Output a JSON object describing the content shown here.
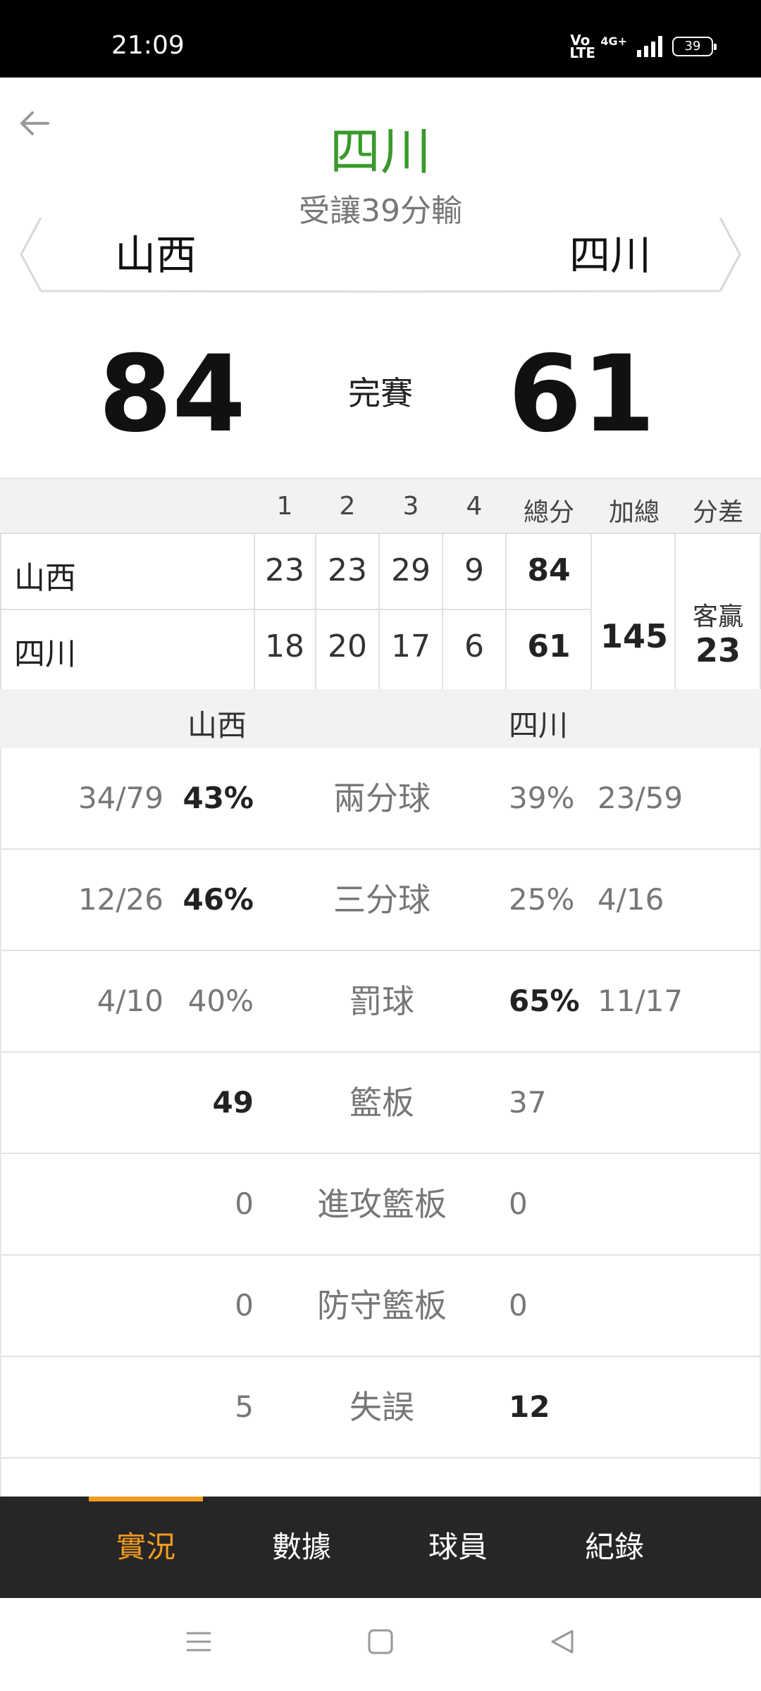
{
  "status_bar": {
    "time": "21:09",
    "volte": "Vo LTE",
    "network": "4G+",
    "battery": "39"
  },
  "header": {
    "winner": "四川",
    "handicap_result": "受讓39分輸",
    "home_team": "山西",
    "away_team": "四川"
  },
  "score": {
    "home": "84",
    "status": "完賽",
    "away": "61"
  },
  "quarter_table": {
    "headers": [
      "1",
      "2",
      "3",
      "4",
      "總分",
      "加總",
      "分差"
    ],
    "rows": [
      {
        "team": "山西",
        "q": [
          "23",
          "23",
          "29",
          "9"
        ],
        "total": "84"
      },
      {
        "team": "四川",
        "q": [
          "18",
          "20",
          "17",
          "6"
        ],
        "total": "61"
      }
    ],
    "sum": "145",
    "diff_label": "客贏",
    "diff_value": "23"
  },
  "stats": {
    "home_team": "山西",
    "away_team": "四川",
    "rows": [
      {
        "label": "兩分球",
        "home_frac": "34/79",
        "home_pct": "43%",
        "away_pct": "39%",
        "away_frac": "23/59",
        "leader": "home"
      },
      {
        "label": "三分球",
        "home_frac": "12/26",
        "home_pct": "46%",
        "away_pct": "25%",
        "away_frac": "4/16",
        "leader": "home"
      },
      {
        "label": "罰球",
        "home_frac": "4/10",
        "home_pct": "40%",
        "away_pct": "65%",
        "away_frac": "11/17",
        "leader": "away"
      },
      {
        "label": "籃板",
        "home_frac": "",
        "home_pct": "49",
        "away_pct": "37",
        "away_frac": "",
        "leader": "home"
      },
      {
        "label": "進攻籃板",
        "home_frac": "",
        "home_pct": "0",
        "away_pct": "0",
        "away_frac": "",
        "leader": "none"
      },
      {
        "label": "防守籃板",
        "home_frac": "",
        "home_pct": "0",
        "away_pct": "0",
        "away_frac": "",
        "leader": "none"
      },
      {
        "label": "失誤",
        "home_frac": "",
        "home_pct": "5",
        "away_pct": "12",
        "away_frac": "",
        "leader": "away"
      },
      {
        "label": "",
        "home_frac": "",
        "home_pct": "",
        "away_pct": "",
        "away_frac": "",
        "leader": "none"
      }
    ]
  },
  "tabs": [
    {
      "label": "實況",
      "active": true
    },
    {
      "label": "數據",
      "active": false
    },
    {
      "label": "球員",
      "active": false
    },
    {
      "label": "紀錄",
      "active": false
    }
  ],
  "colors": {
    "winner_green": "#3a9a2b",
    "accent_orange": "#f29b20",
    "tabbar_bg": "#262626"
  },
  "icons": {
    "back": "arrow-left-icon",
    "nav_menu": "menu-icon",
    "nav_home": "square-icon",
    "nav_back": "triangle-back-icon"
  }
}
